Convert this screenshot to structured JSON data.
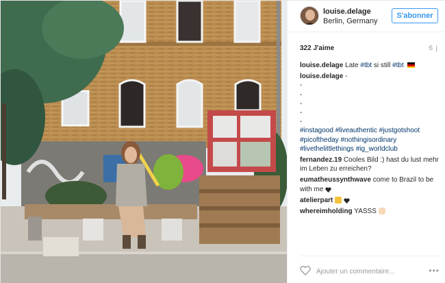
{
  "post": {
    "username": "louise.delage",
    "location": "Berlin, Germany",
    "follow_label": "S'abonner",
    "likes": "322 J'aime",
    "time": "6 j"
  },
  "comments": [
    {
      "user": "louise.delage",
      "text": "Late ",
      "tags": [
        "#tbt",
        " si still ",
        "#tbt"
      ],
      "flag": "german-flag"
    },
    {
      "user": "louise.delage",
      "text": "-",
      "lines": [
        "-",
        "-",
        "-",
        "-",
        "-"
      ],
      "hashtags": [
        "#instagood",
        "#liveauthentic",
        "#justgotshoot",
        "#picoftheday",
        "#nothingisordinary",
        "#livethelittlethings",
        "#ig_worldclub"
      ]
    },
    {
      "user": "fernandez.19",
      "text": "Cooles Bild :) hast du lust mehr im Leben zu erreichen?"
    },
    {
      "user": "eumatheussynthwave",
      "text": "come to Brazil to be with me",
      "emoji": "black-heart"
    },
    {
      "user": "atelierpart",
      "emoji": "thumbs-up-heart"
    },
    {
      "user": "whereimholding",
      "text": "YASSS",
      "emoji": "hand"
    }
  ],
  "footer": {
    "comment_placeholder": "Ajouter un commentaire...",
    "more_label": "•••"
  },
  "icons": {
    "like": "heart-icon",
    "options": "more-options-icon"
  },
  "colors": {
    "link": "#003569",
    "follow": "#3897f0",
    "muted": "#999999"
  }
}
